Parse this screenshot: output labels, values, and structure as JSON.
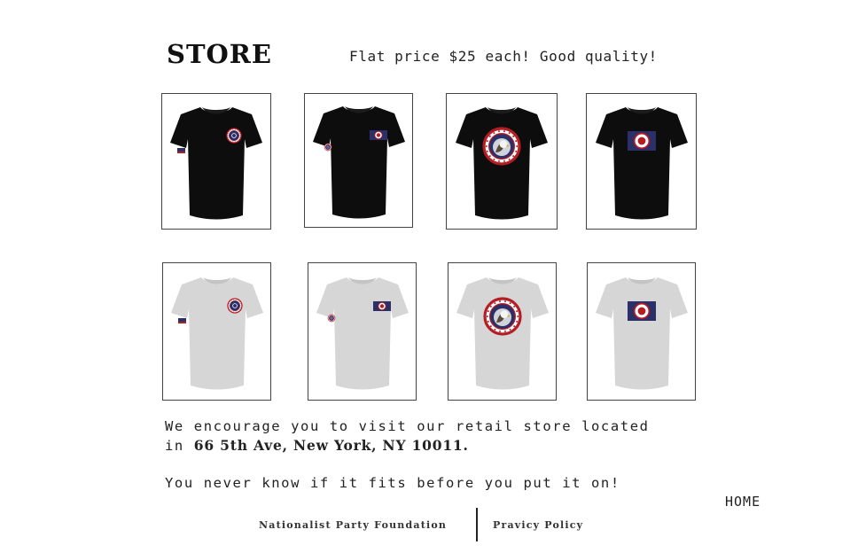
{
  "header": {
    "title": "STORE",
    "tagline": "Flat price $25 each! Good quality!"
  },
  "products": [
    {
      "shirt_color": "#0d0d0d",
      "design": "small-emblem-with-sleeve-flag",
      "icon": "tshirt-icon"
    },
    {
      "shirt_color": "#0d0d0d",
      "design": "chest-banner-with-sleeve-emblem",
      "icon": "tshirt-icon"
    },
    {
      "shirt_color": "#0d0d0d",
      "design": "large-eagle-emblem",
      "icon": "tshirt-icon"
    },
    {
      "shirt_color": "#0d0d0d",
      "design": "large-chest-banner",
      "icon": "tshirt-icon"
    },
    {
      "shirt_color": "#d6d6d6",
      "design": "small-emblem-with-sleeve-flag",
      "icon": "tshirt-icon"
    },
    {
      "shirt_color": "#d6d6d6",
      "design": "chest-banner-with-sleeve-emblem",
      "icon": "tshirt-icon"
    },
    {
      "shirt_color": "#d6d6d6",
      "design": "large-eagle-emblem",
      "icon": "tshirt-icon"
    },
    {
      "shirt_color": "#d6d6d6",
      "design": "large-chest-banner",
      "icon": "tshirt-icon"
    }
  ],
  "info": {
    "line1": "We encourage you to visit our retail store located",
    "line2_prefix": "in ",
    "address": "66 5th Ave, New York, NY 10011.",
    "line3": "You never know if it fits before you put it on!"
  },
  "nav": {
    "home": "HOME"
  },
  "footer": {
    "foundation": "Nationalist Party Foundation",
    "policy": "Pravicy Policy"
  },
  "colors": {
    "emblem_navy": "#2b3068",
    "emblem_red": "#b51d24",
    "emblem_white": "#ffffff"
  }
}
